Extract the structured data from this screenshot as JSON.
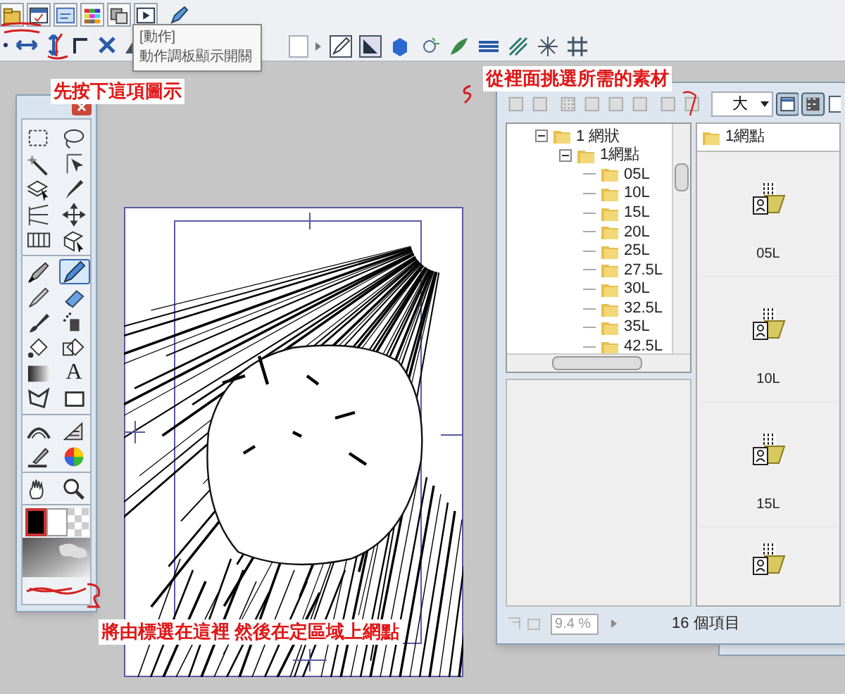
{
  "tooltip": {
    "title": "[動作]",
    "text": "動作調板顯示開關"
  },
  "annotations": [
    {
      "text": "先按下這項圖示"
    },
    {
      "text": "從裡面挑選所需的素材"
    },
    {
      "text": "將由標選在這裡 然後在定區域上網點"
    }
  ],
  "tool_palette": {
    "tools": [
      {
        "selected": false
      },
      {
        "selected": false
      },
      {
        "selected": false
      },
      {
        "selected": false
      },
      {
        "selected": false
      },
      {
        "selected": false
      },
      {
        "selected": false
      },
      {
        "selected": false
      },
      {
        "selected": false
      },
      {
        "selected": false
      },
      {
        "selected": false
      },
      {
        "selected": true
      },
      {
        "selected": false
      },
      {
        "selected": false
      },
      {
        "selected": false
      },
      {
        "selected": false
      },
      {
        "selected": false
      },
      {
        "selected": false
      },
      {
        "selected": false
      },
      {
        "selected": false,
        "glyph": "A"
      },
      {
        "selected": false
      },
      {
        "selected": false
      },
      {
        "selected": false
      },
      {
        "selected": false
      },
      {
        "selected": false
      },
      {
        "selected": false
      },
      {
        "selected": false
      },
      {
        "selected": false
      }
    ]
  },
  "material_window": {
    "size_dropdown": "大",
    "tree": [
      {
        "label": "1 網狀",
        "expanded": true,
        "children": [
          {
            "label": "1網點",
            "expanded": true,
            "children": [
              {
                "label": "05L"
              },
              {
                "label": "10L"
              },
              {
                "label": "15L"
              },
              {
                "label": "20L"
              },
              {
                "label": "25L"
              },
              {
                "label": "27.5L"
              },
              {
                "label": "30L"
              },
              {
                "label": "32.5L"
              },
              {
                "label": "35L"
              },
              {
                "label": "42.5L"
              }
            ]
          }
        ]
      }
    ],
    "folder_header": "1網點",
    "items": [
      {
        "label": "05L"
      },
      {
        "label": "10L"
      },
      {
        "label": "15L"
      }
    ],
    "zoom": "9.4 %",
    "status": "16 個項目"
  }
}
